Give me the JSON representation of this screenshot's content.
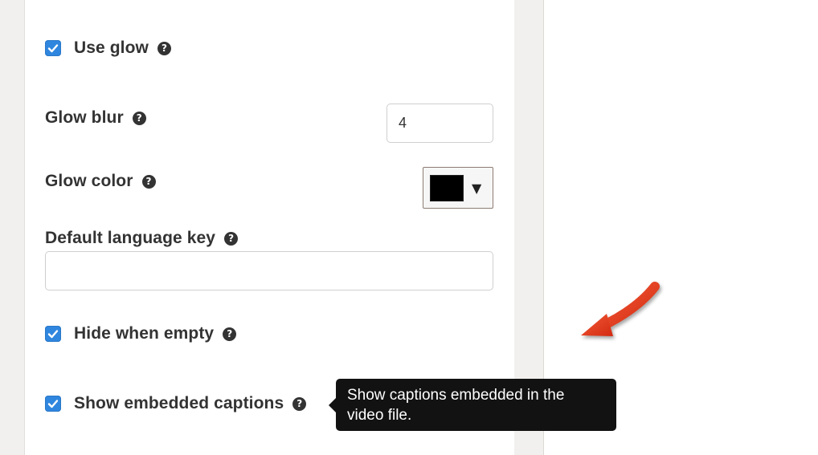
{
  "settings": {
    "use_glow": {
      "label": "Use glow",
      "checked": true
    },
    "glow_blur": {
      "label": "Glow blur",
      "value": "4"
    },
    "glow_color": {
      "label": "Glow color",
      "value": "#000000"
    },
    "default_language_key": {
      "label": "Default language key",
      "value": ""
    },
    "hide_when_empty": {
      "label": "Hide when empty",
      "checked": true
    },
    "show_embedded_captions": {
      "label": "Show embedded captions",
      "checked": true
    }
  },
  "tooltip": {
    "text_line1": "Show captions embedded in the",
    "text_line2": "video file."
  },
  "icons": {
    "help": "question-circle-icon",
    "check": "checkmark-icon",
    "dropdown": "caret-down-icon",
    "annotation": "red-arrow-icon"
  },
  "colors": {
    "checkbox": "#2f86de",
    "tooltip_bg": "#121212",
    "arrow": "#e2391b"
  }
}
